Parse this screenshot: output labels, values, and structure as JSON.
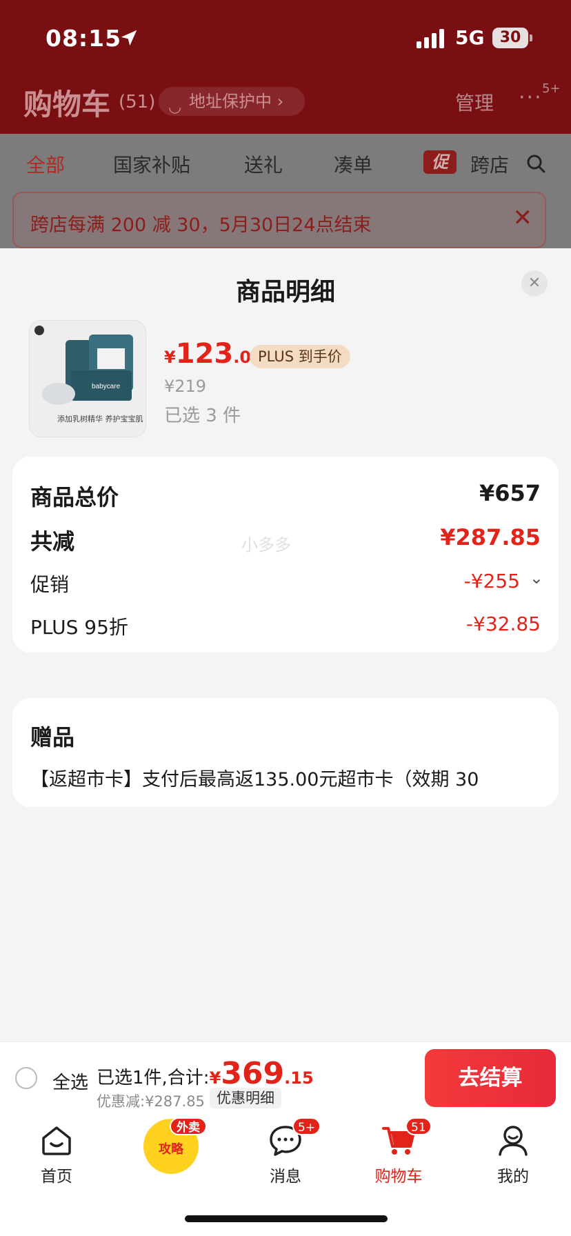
{
  "status_bar": {
    "time": "08:15",
    "network": "5G",
    "battery": "30"
  },
  "header": {
    "title": "购物车",
    "count": "(51)",
    "address_protect": "地址保护中 ›",
    "manage": "管理",
    "more_badge": "5+"
  },
  "tabs": [
    {
      "label": "全部",
      "active": true
    },
    {
      "label": "国家补贴"
    },
    {
      "label": "送礼"
    },
    {
      "label": "凑单"
    },
    {
      "label": "跨店"
    }
  ],
  "promo_tag": "促",
  "notice": {
    "text": "跨店每满 200 减 30，5月30日24点结束"
  },
  "sheet": {
    "title": "商品明细",
    "product": {
      "image_text": "添加乳树精华 养护宝宝肌",
      "brand_label": "babycare",
      "price_symbol": "¥",
      "price_int": "123",
      "price_dec": ".05",
      "plus_tag": "PLUS 到手价",
      "original_price": "¥219",
      "selected_count": "已选 3 件"
    },
    "summary": {
      "total_label": "商品总价",
      "total_value": "¥657",
      "discount_label": "共减",
      "discount_value": "¥287.85",
      "promo_label": "促销",
      "promo_value": "-¥255",
      "plus_label": "PLUS 95折",
      "plus_value": "-¥32.85"
    },
    "gift": {
      "title": "赠品",
      "text": "【返超市卡】支付后最高返135.00元超市卡（效期 30"
    },
    "watermark": "小多多"
  },
  "checkout": {
    "select_all": "全选",
    "selected_prefix": "已选1件,合计:",
    "total_symbol": "¥",
    "total_int": "369",
    "total_dec": ".15",
    "discount_line": "优惠减:¥287.85",
    "discount_detail": "优惠明细",
    "button": "去结算"
  },
  "tabbar": [
    {
      "label": "首页",
      "icon": "home-icon"
    },
    {
      "label": "攻略",
      "icon": "waimai-icon",
      "badge": "外卖"
    },
    {
      "label": "消息",
      "icon": "message-icon",
      "badge": "5+"
    },
    {
      "label": "购物车",
      "icon": "cart-icon",
      "badge": "51",
      "active": true
    },
    {
      "label": "我的",
      "icon": "profile-icon"
    }
  ],
  "colors": {
    "accent": "#e2231a",
    "header_bg": "#7a0f13",
    "plus_tag_bg": "#f4dcc4"
  }
}
